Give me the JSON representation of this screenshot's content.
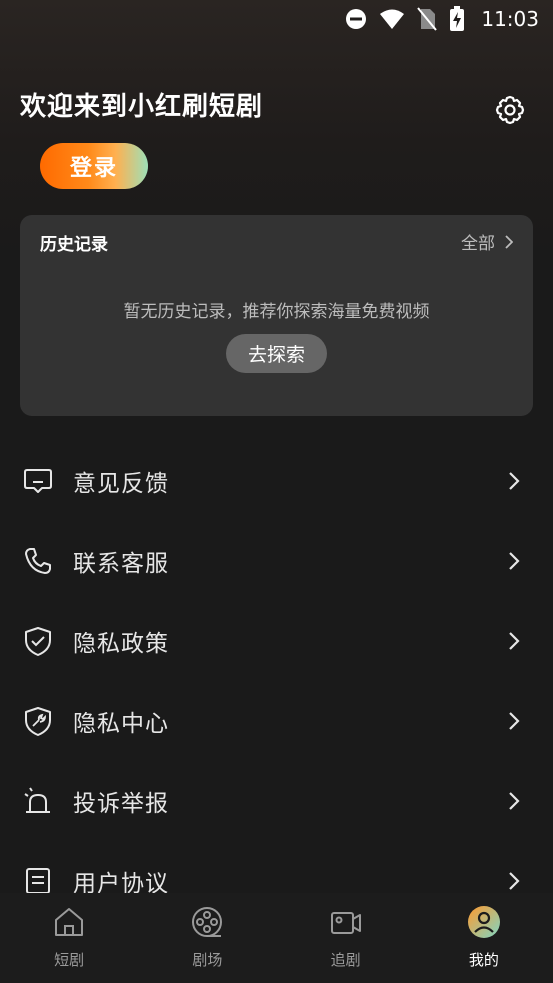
{
  "status_bar": {
    "time": "11:03"
  },
  "header": {
    "welcome": "欢迎来到小红刷短剧",
    "login_label": "登录"
  },
  "history": {
    "title": "历史记录",
    "all_label": "全部",
    "empty_text": "暂无历史记录，推荐你探索海量免费视频",
    "explore_label": "去探索"
  },
  "menu": {
    "items": [
      {
        "label": "意见反馈",
        "icon": "feedback-icon"
      },
      {
        "label": "联系客服",
        "icon": "phone-icon"
      },
      {
        "label": "隐私政策",
        "icon": "shield-check-icon"
      },
      {
        "label": "隐私中心",
        "icon": "shield-wrench-icon"
      },
      {
        "label": "投诉举报",
        "icon": "alarm-icon"
      },
      {
        "label": "用户协议",
        "icon": "document-icon"
      }
    ]
  },
  "tabs": [
    {
      "label": "短剧",
      "icon": "home-icon"
    },
    {
      "label": "剧场",
      "icon": "film-reel-icon"
    },
    {
      "label": "追剧",
      "icon": "video-camera-icon"
    },
    {
      "label": "我的",
      "icon": "user-avatar-icon",
      "active": true
    }
  ],
  "colors": {
    "background": "#1a1a1a",
    "card": "#333333",
    "login_gradient_start": "#ff6a00",
    "login_gradient_end": "#9de0b8"
  }
}
